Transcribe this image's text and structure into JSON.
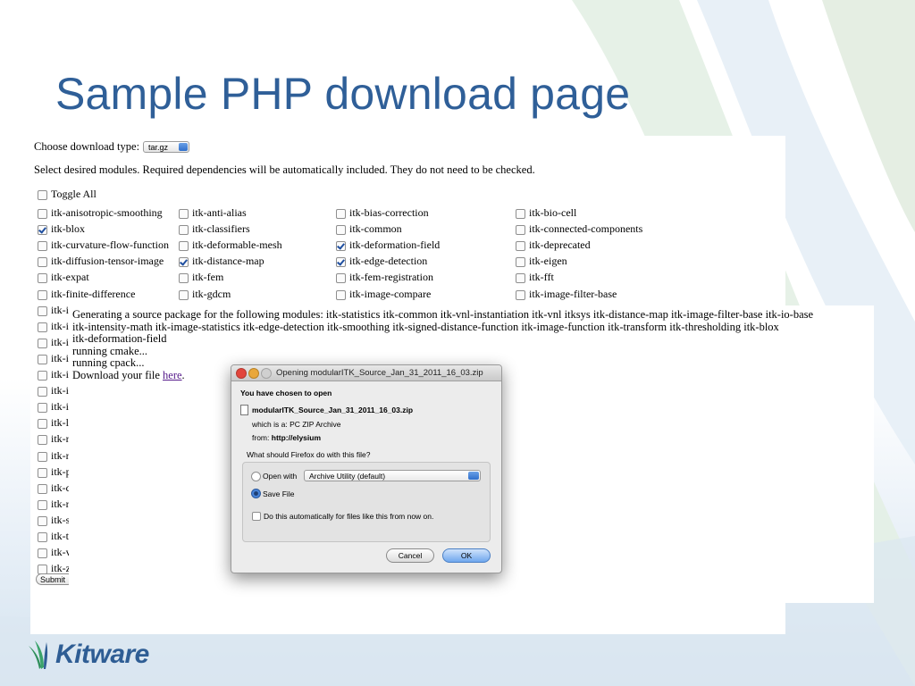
{
  "slide": {
    "title": "Sample PHP download page",
    "logo_text": "Kitware"
  },
  "form": {
    "choose_type_label": "Choose download type:",
    "download_type": "tar.gz",
    "instructions": "Select desired modules. Required dependencies will be automatically included. They do not need to be checked.",
    "toggle_all_label": "Toggle All",
    "toggle_all_checked": false,
    "modules": [
      [
        {
          "label": "itk-anisotropic-smoothing",
          "checked": false
        },
        {
          "label": "itk-anti-alias",
          "checked": false
        },
        {
          "label": "itk-bias-correction",
          "checked": false
        },
        {
          "label": "itk-bio-cell",
          "checked": false
        }
      ],
      [
        {
          "label": "itk-blox",
          "checked": true
        },
        {
          "label": "itk-classifiers",
          "checked": false
        },
        {
          "label": "itk-common",
          "checked": false
        },
        {
          "label": "itk-connected-components",
          "checked": false
        }
      ],
      [
        {
          "label": "itk-curvature-flow-function",
          "checked": false
        },
        {
          "label": "itk-deformable-mesh",
          "checked": false
        },
        {
          "label": "itk-deformation-field",
          "checked": true
        },
        {
          "label": "itk-deprecated",
          "checked": false
        }
      ],
      [
        {
          "label": "itk-diffusion-tensor-image",
          "checked": false
        },
        {
          "label": "itk-distance-map",
          "checked": true
        },
        {
          "label": "itk-edge-detection",
          "checked": true
        },
        {
          "label": "itk-eigen",
          "checked": false
        }
      ],
      [
        {
          "label": "itk-expat",
          "checked": false
        },
        {
          "label": "itk-fem",
          "checked": false
        },
        {
          "label": "itk-fem-registration",
          "checked": false
        },
        {
          "label": "itk-fft",
          "checked": false
        }
      ],
      [
        {
          "label": "itk-finite-difference",
          "checked": false
        },
        {
          "label": "itk-gdcm",
          "checked": false
        },
        {
          "label": "itk-image-compare",
          "checked": false
        },
        {
          "label": "itk-image-filter-base",
          "checked": false
        }
      ]
    ],
    "partial_rows": [
      "itk-i",
      "itk-i",
      "itk-i",
      "itk-i",
      "itk-i",
      "itk-i",
      "itk-i",
      "itk-l",
      "itk-r",
      "itk-r",
      "itk-p",
      "itk-q",
      "itk-r",
      "itk-s",
      "itk-t",
      "itk-v",
      "itk-z"
    ],
    "submit_label": "Submit"
  },
  "output": {
    "lines": [
      "Generating a source package for the following modules: itk-statistics itk-common itk-vnl-instantiation itk-vnl itksys itk-distance-map itk-image-filter-base itk-io-base",
      "itk-intensity-math itk-image-statistics itk-edge-detection itk-smoothing itk-signed-distance-function itk-image-function itk-transform itk-thresholding itk-blox",
      "itk-deformation-field",
      "running cmake...",
      "running cpack..."
    ],
    "download_prefix": "Download your file ",
    "download_link": "here",
    "download_suffix": "."
  },
  "dialog": {
    "title": "Opening modularITK_Source_Jan_31_2011_16_03.zip",
    "chosen_label": "You have chosen to open",
    "filename": "modularITK_Source_Jan_31_2011_16_03.zip",
    "which_is_label": "which is a:",
    "file_type": "PC ZIP Archive",
    "from_label": "from:",
    "from_value": "http://elysium",
    "question": "What should Firefox do with this file?",
    "open_with_label": "Open with",
    "open_with_app": "Archive Utility (default)",
    "save_file_label": "Save File",
    "selected_action": "save",
    "auto_label": "Do this automatically for files like this from now on.",
    "auto_checked": false,
    "cancel_label": "Cancel",
    "ok_label": "OK"
  },
  "colors": {
    "title": "#2f5f98",
    "logo": "#2e5d94",
    "link": "#551a8b"
  }
}
